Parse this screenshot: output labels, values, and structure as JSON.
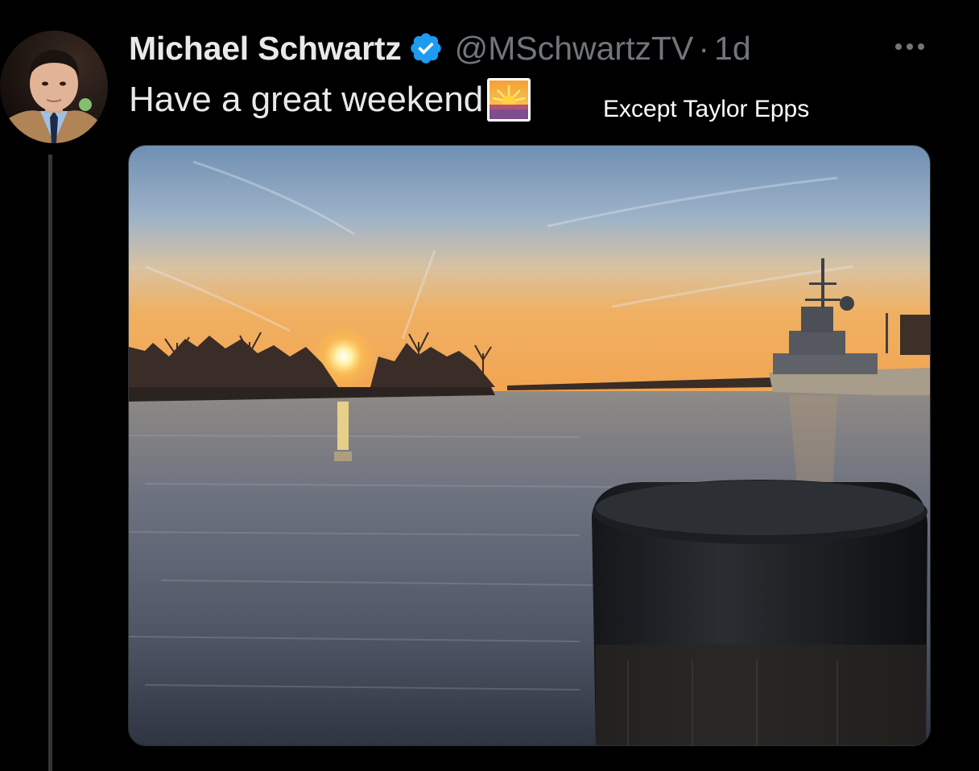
{
  "tweet": {
    "author": {
      "display_name": "Michael Schwartz",
      "handle": "@MSchwartzTV",
      "verified": true,
      "avatar_icon": "profile-photo"
    },
    "separator": "·",
    "timestamp": "1d",
    "text": "Have a great weekend",
    "emoji": "sunrise-emoji",
    "overlay_caption": "Except Taylor Epps",
    "media": {
      "type": "photo",
      "subject": "sunset-over-harbor"
    }
  },
  "colors": {
    "background": "#000000",
    "text_primary": "#e7e9ea",
    "text_secondary": "#71767b",
    "verified_badge": "#1d9bf0",
    "thread_line": "#333639"
  }
}
